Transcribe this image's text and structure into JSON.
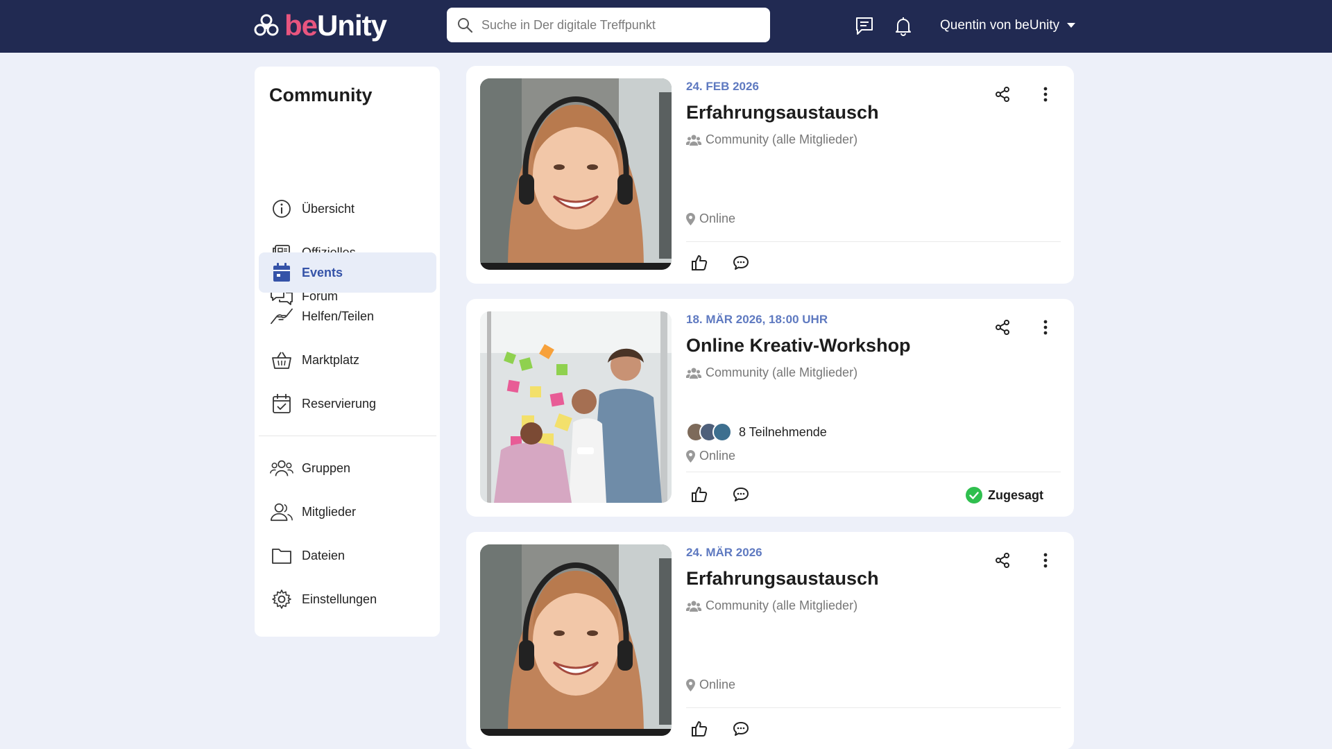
{
  "header": {
    "logo_prefix": "be",
    "logo_suffix": "Unity",
    "search_placeholder": "Suche in Der digitale Treffpunkt",
    "user_name": "Quentin von beUnity"
  },
  "sidebar": {
    "title": "Community",
    "items": [
      {
        "label": "Übersicht",
        "icon": "info-icon"
      },
      {
        "label": "Offizielles",
        "icon": "newspaper-icon"
      },
      {
        "label": "Forum",
        "icon": "chat-bubbles-icon"
      },
      {
        "label": "Events",
        "icon": "calendar-icon",
        "active": true
      },
      {
        "label": "Helfen/Teilen",
        "icon": "helping-hand-icon"
      },
      {
        "label": "Marktplatz",
        "icon": "basket-icon"
      },
      {
        "label": "Reservierung",
        "icon": "calendar-check-icon"
      },
      {
        "label": "Gruppen",
        "icon": "group-icon"
      },
      {
        "label": "Mitglieder",
        "icon": "members-icon"
      },
      {
        "label": "Dateien",
        "icon": "folder-icon"
      },
      {
        "label": "Einstellungen",
        "icon": "gear-icon"
      }
    ]
  },
  "events": [
    {
      "date": "24. FEB 2026",
      "title": "Erfahrungsaustausch",
      "audience": "Community (alle Mitglieder)",
      "location": "Online"
    },
    {
      "date": "18. MÄR 2026, 18:00 UHR",
      "title": "Online Kreativ-Workshop",
      "audience": "Community (alle Mitglieder)",
      "participants": "8 Teilnehmende",
      "location": "Online",
      "status": "Zugesagt"
    },
    {
      "date": "24. MÄR 2026",
      "title": "Erfahrungsaustausch",
      "audience": "Community (alle Mitglieder)",
      "location": "Online"
    }
  ],
  "colors": {
    "topbar": "#212a52",
    "accent": "#5e79c0",
    "brand_pink": "#e8557f",
    "success": "#2fbf4e",
    "background": "#edf0f9"
  }
}
